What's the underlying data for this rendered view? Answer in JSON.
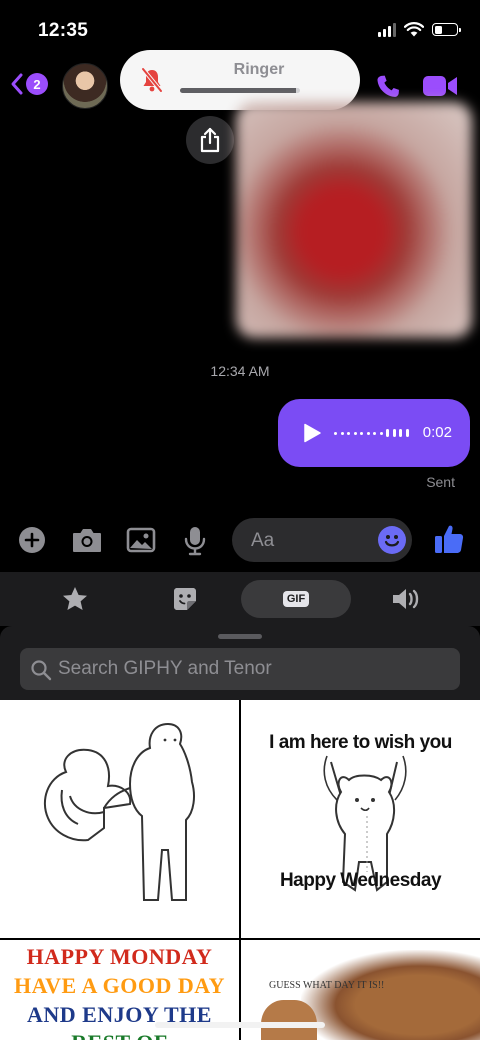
{
  "status_bar": {
    "time": "12:35"
  },
  "header": {
    "back_badge_count": "2"
  },
  "ringer_hud": {
    "label": "Ringer",
    "muted": true,
    "volume_level": 0.97
  },
  "conversation": {
    "timestamp": "12:34 AM",
    "voice_message": {
      "duration": "0:02"
    },
    "delivery_status": "Sent"
  },
  "composer": {
    "input_placeholder": "Aa"
  },
  "tray_tabs": [
    {
      "id": "favorites",
      "icon": "star-icon",
      "active": false
    },
    {
      "id": "stickers",
      "icon": "sticker-icon",
      "active": false
    },
    {
      "id": "gif",
      "label": "GIF",
      "active": true
    },
    {
      "id": "sounds",
      "icon": "speaker-icon",
      "active": false
    }
  ],
  "gif_panel": {
    "search_placeholder": "Search GIPHY and Tenor",
    "gifs": [
      {
        "caption_top": "",
        "caption_bottom": ""
      },
      {
        "caption_top": "I am here to wish you",
        "caption_bottom": "Happy Wednesday"
      },
      {
        "lines": [
          "HAPPY MONDAY",
          "HAVE A GOOD DAY",
          "AND ENJOY THE",
          "REST OF"
        ]
      },
      {
        "caption_top": "GUESS WHAT DAY IT IS!!"
      }
    ]
  },
  "colors": {
    "accent": "#7b4cf4",
    "accent_icon": "#9b4dfc",
    "like": "#4a6cf7",
    "muted_bell": "#e5433f"
  }
}
